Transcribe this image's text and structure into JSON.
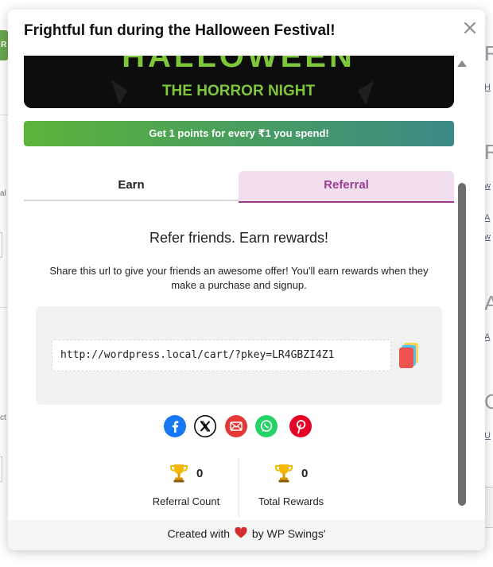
{
  "modal": {
    "title": "Frightful fun during the Halloween Festival!",
    "close_icon": "close-icon"
  },
  "banner": {
    "title_partial": "HALLOWEEN",
    "subtitle": "THE HORROR NIGHT"
  },
  "points_bar": {
    "text": "Get 1 points for every ₹1 you spend!"
  },
  "tabs": [
    {
      "label": "Earn",
      "active": false
    },
    {
      "label": "Referral",
      "active": true
    }
  ],
  "referral": {
    "heading": "Refer friends. Earn rewards!",
    "description": "Share this url to give your friends an awesome offer! You'll earn rewards when they make a purchase and signup.",
    "url": "http://wordpress.local/cart/?pkey=LR4GBZI4Z1",
    "copy_icon": "copy-icon"
  },
  "share": [
    {
      "name": "facebook-icon",
      "color": "#1877f2"
    },
    {
      "name": "x-twitter-icon",
      "color": "#000000"
    },
    {
      "name": "email-icon",
      "color": "#e53935"
    },
    {
      "name": "whatsapp-icon",
      "color": "#25d366"
    },
    {
      "name": "pinterest-icon",
      "color": "#e60023"
    }
  ],
  "stats": {
    "referral_count": {
      "value": "0",
      "label": "Referral Count"
    },
    "total_rewards": {
      "value": "0",
      "label": "Total Rewards"
    }
  },
  "footer": {
    "prefix": "Created with",
    "suffix": "by WP Swings'"
  },
  "colors": {
    "accent": "#9b3e8f",
    "tab_active_bg": "#f1dff0",
    "points_gradient_start": "#5db43a",
    "points_gradient_end": "#3c8a86",
    "banner_text": "#7ec63a"
  }
}
